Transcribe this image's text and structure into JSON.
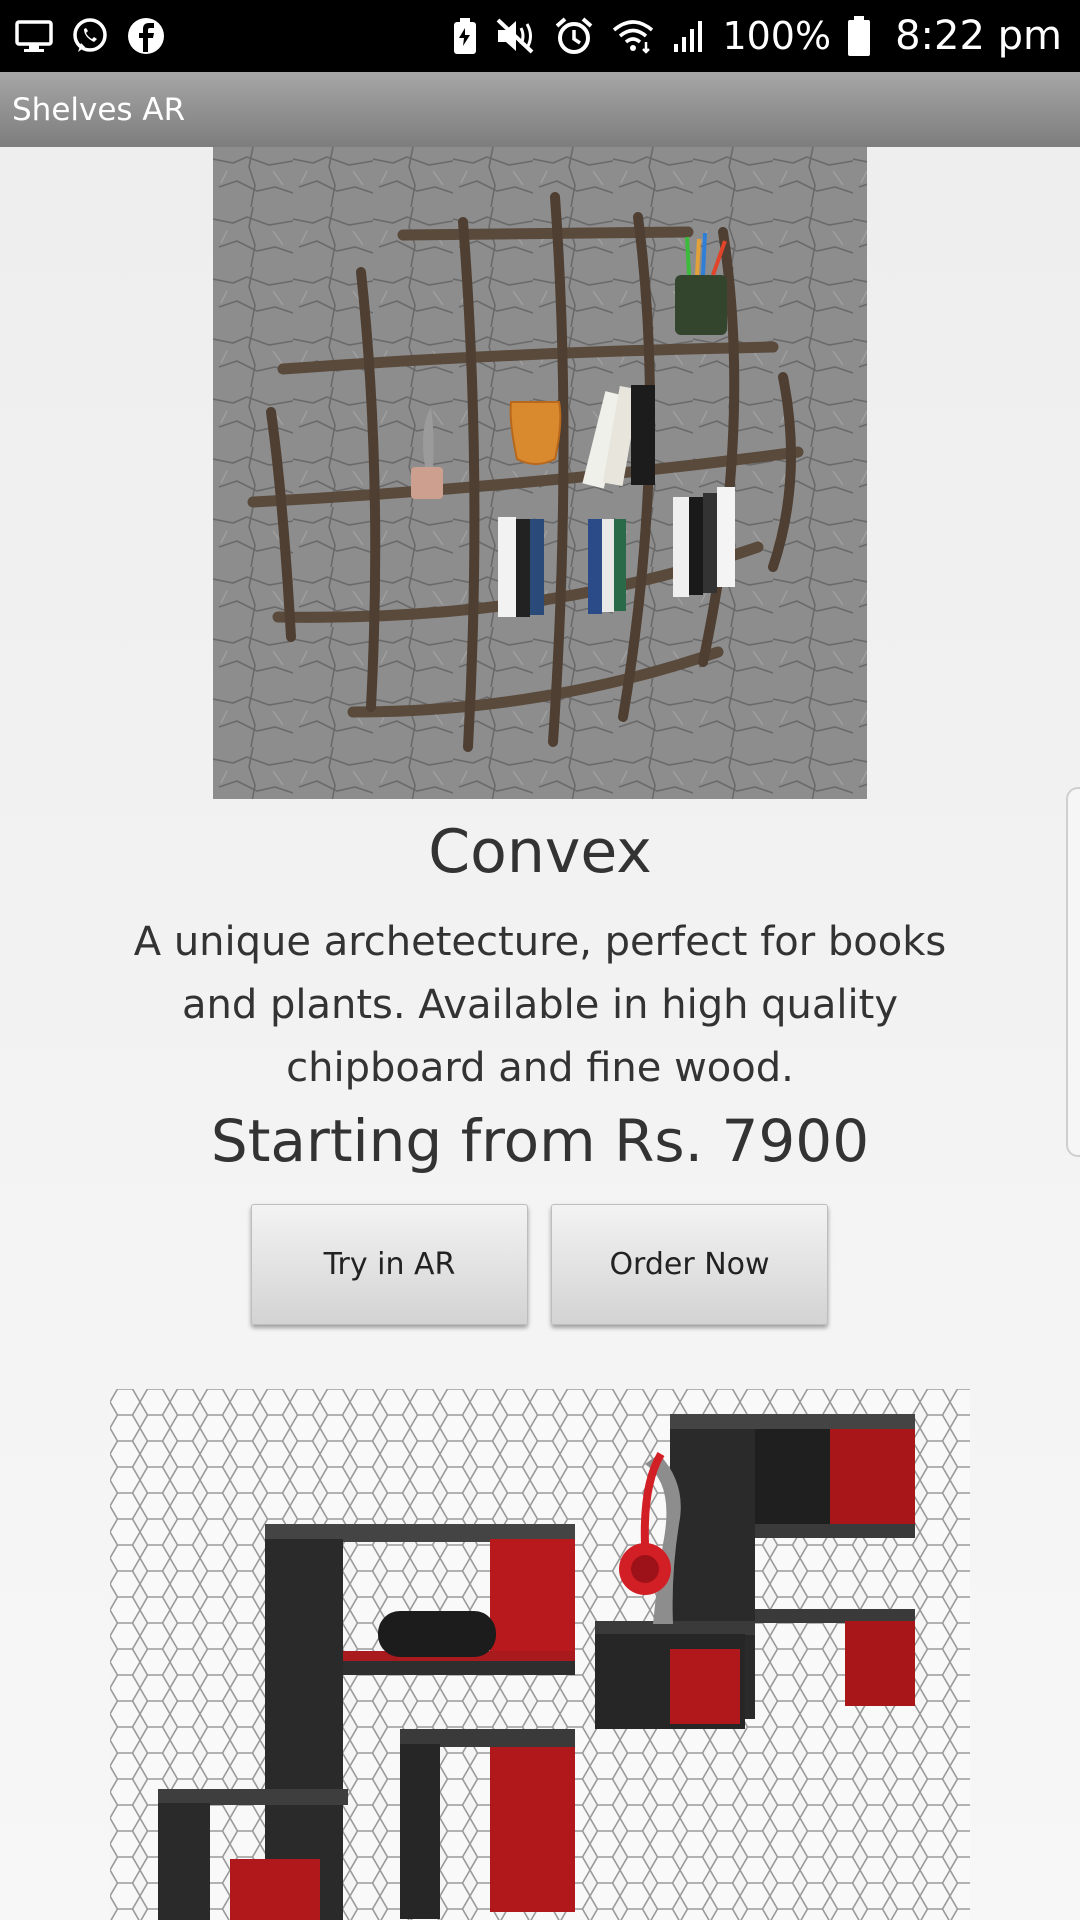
{
  "status_bar": {
    "left_icons": [
      "monitor-icon",
      "whatsapp-icon",
      "facebook-icon"
    ],
    "right_icons": [
      "battery-saver-icon",
      "mute-icon",
      "alarm-icon",
      "wifi-icon",
      "signal-icon",
      "battery-icon"
    ],
    "battery_percent": "100%",
    "time": "8:22 pm"
  },
  "app_bar": {
    "title": "Shelves AR",
    "color_top": "#a6a6a6",
    "color_bottom": "#7d7d7d"
  },
  "product": {
    "name": "Convex",
    "description": "A unique archetecture, perfect for books and plants. Available in high quality chipboard and fine wood.",
    "price": "Starting from Rs. 7900",
    "try_ar_label": "Try in AR",
    "order_label": "Order Now"
  }
}
